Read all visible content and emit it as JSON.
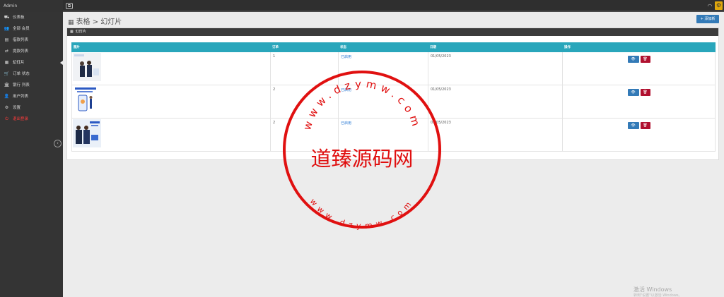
{
  "topbar": {
    "brand": "Admin",
    "toggle_icon": "⧉",
    "user_icon": "◠",
    "settings_icon": "⚙"
  },
  "sidebar": {
    "items": [
      {
        "label": "仪表板",
        "icon": "⛟",
        "name": "sidebar-item-dashboard"
      },
      {
        "label": "全部 会员",
        "icon": "👥",
        "name": "sidebar-item-members"
      },
      {
        "label": "借款列表",
        "icon": "▤",
        "name": "sidebar-item-loans"
      },
      {
        "label": "提款列表",
        "icon": "⇄",
        "name": "sidebar-item-withdrawals"
      },
      {
        "label": "幻灯片",
        "icon": "▦",
        "name": "sidebar-item-slides"
      },
      {
        "label": "订单 状态",
        "icon": "🛒",
        "name": "sidebar-item-order-status"
      },
      {
        "label": "银行 列表",
        "icon": "🏛",
        "name": "sidebar-item-banks"
      },
      {
        "label": "用户列表",
        "icon": "👤",
        "name": "sidebar-item-users"
      },
      {
        "label": "设置",
        "icon": "⚙",
        "name": "sidebar-item-settings"
      },
      {
        "label": "退出登录",
        "icon": "⏻",
        "name": "sidebar-item-logout"
      }
    ],
    "active_index": 4,
    "collapse_icon": "‹"
  },
  "header": {
    "title": "表格 > 幻灯片",
    "title_icon": "▦",
    "add_button": "+ 添加新"
  },
  "panel": {
    "heading": "幻灯片",
    "heading_icon": "▦"
  },
  "table": {
    "columns": [
      "图片",
      "订单",
      "状态",
      "日期",
      "操作"
    ],
    "rows": [
      {
        "order": "1",
        "status": "已启用",
        "date": "01/05/2023"
      },
      {
        "order": "2",
        "status": "已启用",
        "date": "01/05/2023"
      },
      {
        "order": "2",
        "status": "已启用",
        "date": "01/05/2023"
      }
    ],
    "view_icon": "👁",
    "delete_icon": "🗑"
  },
  "watermark": {
    "main": "道臻源码网",
    "arc_top": "www.dzymw.com",
    "arc_bottom": "www.dzymw.com"
  },
  "os_notice": {
    "title": "激活 Windows",
    "subtitle": "转到\"设置\"以激活 Windows。"
  },
  "colors": {
    "table_header": "#29a6bb",
    "primary": "#337ab7",
    "danger": "#b0102f",
    "stamp_red": "#e01010"
  }
}
